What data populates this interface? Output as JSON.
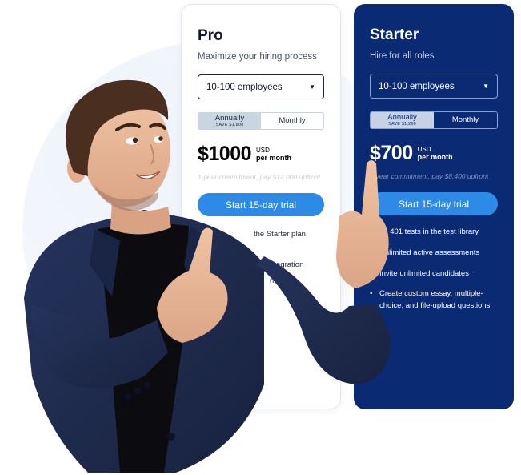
{
  "pro": {
    "name": "Pro",
    "subtitle": "Maximize your hiring process",
    "employees_select": "10-100 employees",
    "billing": {
      "annually": "Annually",
      "annually_save": "SAVE $1,800",
      "monthly": "Monthly"
    },
    "price": "$1000",
    "currency": "USD",
    "period": "per month",
    "commitment": "1-year commitment, pay $12,000 upfront",
    "cta": "Start 15-day trial",
    "feature_fragments": [
      "the Starter plan,",
      "integration",
      "ng"
    ]
  },
  "starter": {
    "name": "Starter",
    "subtitle": "Hire for all roles",
    "employees_select": "10-100 employees",
    "billing": {
      "annually": "Annually",
      "annually_save": "SAVE $1,260",
      "monthly": "Monthly"
    },
    "price": "$700",
    "currency": "USD",
    "period": "per month",
    "commitment": "1-year commitment, pay $8,400 upfront",
    "cta": "Start 15-day trial",
    "features": [
      "All 401 tests in the test library",
      "Unlimited active assessments",
      "Invite unlimited candidates",
      "Create custom essay, multiple-choice, and file-upload questions"
    ]
  },
  "colors": {
    "starter_bg": "#0a2a73",
    "cta": "#2d8ae6",
    "blazer": "#1c2748"
  }
}
